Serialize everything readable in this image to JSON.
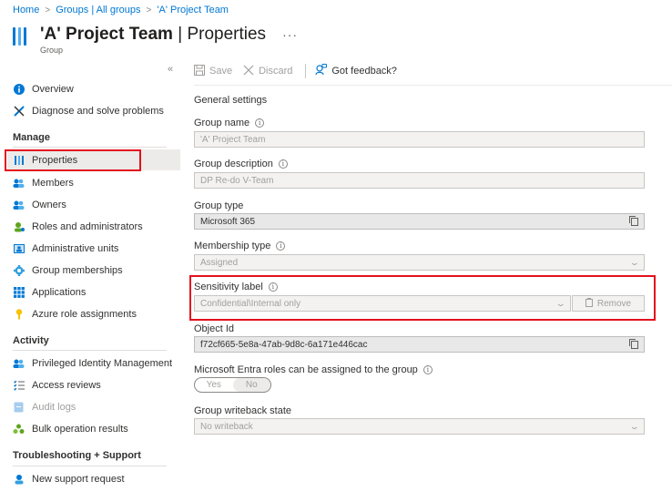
{
  "breadcrumb": [
    "Home",
    "Groups | All groups",
    "'A' Project Team"
  ],
  "header": {
    "title_strong": "'A' Project Team",
    "title_sep": " | ",
    "title_light": "Properties",
    "subtitle": "Group",
    "more": "···",
    "collapse": "«"
  },
  "sidebar": {
    "top": [
      {
        "label": "Overview",
        "icon": "info-icon"
      },
      {
        "label": "Diagnose and solve problems",
        "icon": "wrench-icon"
      }
    ],
    "manage_title": "Manage",
    "manage": [
      {
        "label": "Properties",
        "icon": "properties-icon",
        "selected": true
      },
      {
        "label": "Members",
        "icon": "members-icon"
      },
      {
        "label": "Owners",
        "icon": "owners-icon"
      },
      {
        "label": "Roles and administrators",
        "icon": "roles-icon"
      },
      {
        "label": "Administrative units",
        "icon": "admin-units-icon"
      },
      {
        "label": "Group memberships",
        "icon": "group-memberships-icon"
      },
      {
        "label": "Applications",
        "icon": "applications-icon"
      },
      {
        "label": "Azure role assignments",
        "icon": "key-icon"
      }
    ],
    "activity_title": "Activity",
    "activity": [
      {
        "label": "Privileged Identity Management",
        "icon": "pim-icon"
      },
      {
        "label": "Access reviews",
        "icon": "checklist-icon"
      },
      {
        "label": "Audit logs",
        "icon": "audit-log-icon",
        "disabled": true
      },
      {
        "label": "Bulk operation results",
        "icon": "bulk-icon"
      }
    ],
    "support_title": "Troubleshooting + Support",
    "support": [
      {
        "label": "New support request",
        "icon": "support-icon"
      }
    ]
  },
  "toolbar": {
    "save": "Save",
    "discard": "Discard",
    "feedback": "Got feedback?"
  },
  "form": {
    "section_title": "General settings",
    "group_name_label": "Group name",
    "group_name_value": "'A' Project Team",
    "group_description_label": "Group description",
    "group_description_value": "DP Re-do V-Team",
    "group_type_label": "Group type",
    "group_type_value": "Microsoft 365",
    "membership_type_label": "Membership type",
    "membership_type_value": "Assigned",
    "sensitivity_label": "Sensitivity label",
    "sensitivity_value": "Confidential\\Internal only",
    "remove_label": "Remove",
    "object_id_label": "Object Id",
    "object_id_value": "f72cf665-5e8a-47ab-9d8c-6a171e446cac",
    "entra_roles_label": "Microsoft Entra roles can be assigned to the group",
    "entra_roles_options": [
      "Yes",
      "No"
    ],
    "entra_roles_selected": "No",
    "writeback_label": "Group writeback state",
    "writeback_value": "No writeback"
  },
  "colors": {
    "accent": "#0078d4",
    "highlight": "#e3101e"
  }
}
